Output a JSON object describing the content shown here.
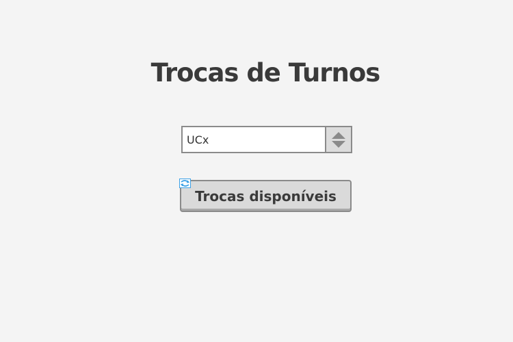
{
  "page": {
    "title": "Trocas de Turnos"
  },
  "spinner": {
    "value": "UCx"
  },
  "button": {
    "label": "Trocas disponíveis",
    "icon": "broken-image-icon"
  },
  "colors": {
    "background": "#f4f4f4",
    "text": "#3a3a3a",
    "border": "#8a8a8a",
    "button_bg": "#dadada",
    "icon_blue": "#3ba0e6"
  }
}
